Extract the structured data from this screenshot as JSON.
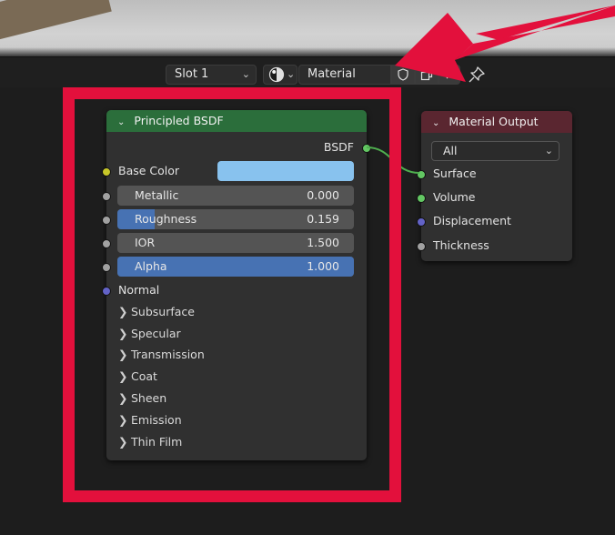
{
  "header": {
    "slot_label": "Slot 1",
    "material_name": "Material",
    "slot_chevron": "⌄",
    "shader_chevron": "⌄"
  },
  "bsdf_node": {
    "title": "Principled BSDF",
    "output_label": "BSDF",
    "base_color_label": "Base Color",
    "base_color_swatch": "#88c2ee",
    "fields": [
      {
        "label": "Metallic",
        "value": "0.000",
        "fill": 0.0
      },
      {
        "label": "Roughness",
        "value": "0.159",
        "fill": 0.159
      },
      {
        "label": "IOR",
        "value": "1.500",
        "fill": 0.0
      },
      {
        "label": "Alpha",
        "value": "1.000",
        "fill": 1.0
      }
    ],
    "normal_label": "Normal",
    "panels": [
      "Subsurface",
      "Specular",
      "Transmission",
      "Coat",
      "Sheen",
      "Emission",
      "Thin Film"
    ]
  },
  "output_node": {
    "title": "Material Output",
    "target": "All",
    "inputs": [
      "Surface",
      "Volume",
      "Displacement",
      "Thickness"
    ]
  },
  "colors": {
    "annotation_red": "#e3103c",
    "header_green": "#2b6e3b",
    "header_red": "#5a2630",
    "socket_green": "#63c763",
    "socket_yellow": "#c7c729",
    "socket_grey": "#a1a1a1",
    "socket_purple": "#6363c7",
    "field_blue": "#4772b3"
  }
}
